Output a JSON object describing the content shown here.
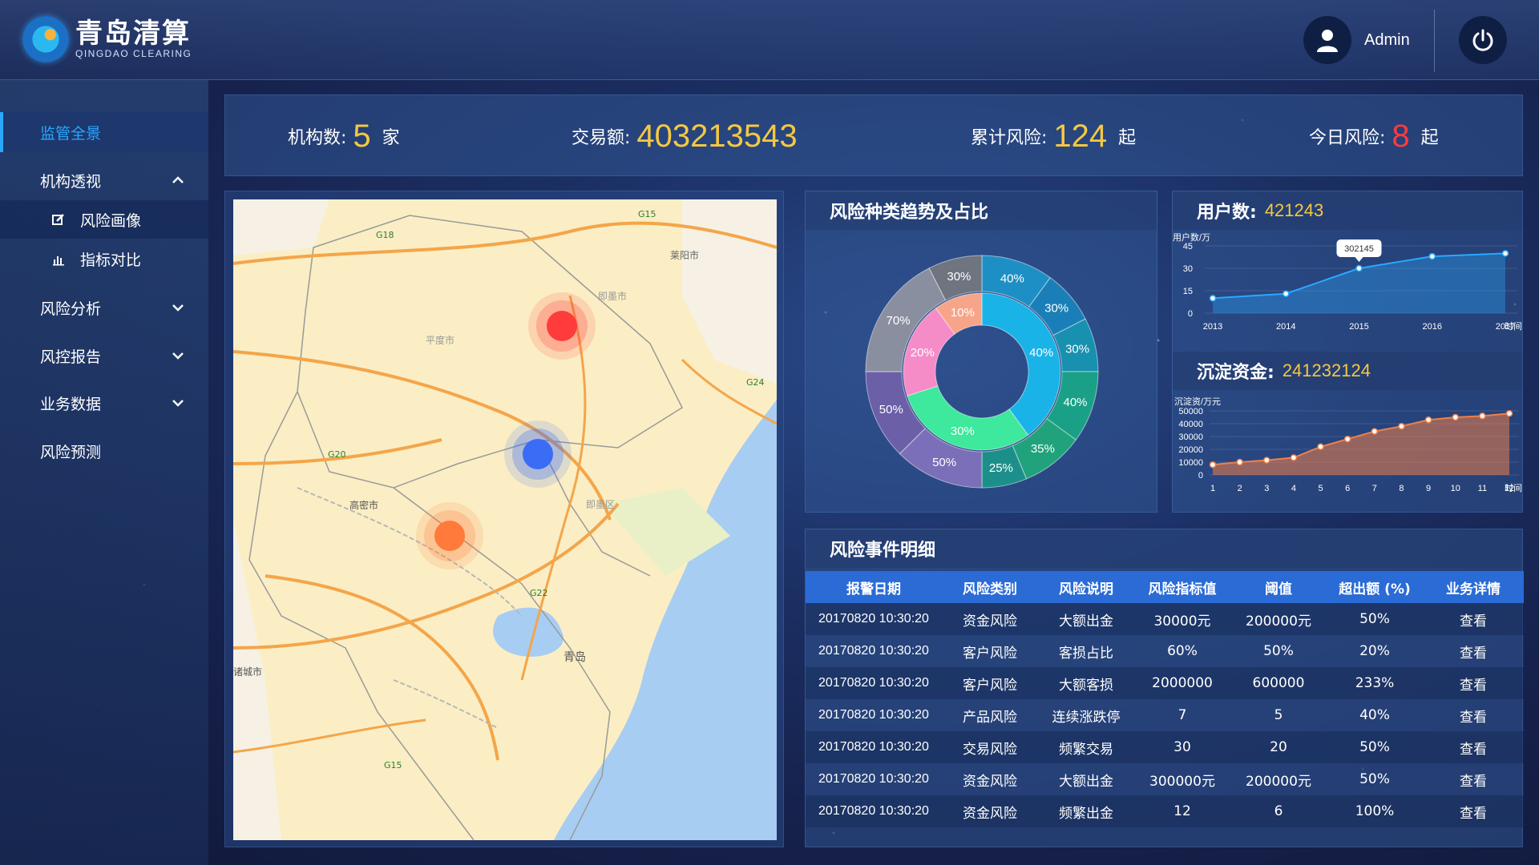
{
  "header": {
    "logo_cn": "青岛清算",
    "logo_en": "QINGDAO CLEARING",
    "user_name": "Admin"
  },
  "sidebar": {
    "items": [
      {
        "label": "监管全景"
      },
      {
        "label": "机构透视"
      },
      {
        "label": "风险画像"
      },
      {
        "label": "指标对比"
      },
      {
        "label": "风险分析"
      },
      {
        "label": "风控报告"
      },
      {
        "label": "业务数据"
      },
      {
        "label": "风险预测"
      }
    ]
  },
  "stats": {
    "org_label": "机构数:",
    "org_value": "5",
    "org_unit": "家",
    "trade_label": "交易额:",
    "trade_value": "403213543",
    "cum_label": "累计风险:",
    "cum_value": "124",
    "cum_unit": "起",
    "today_label": "今日风险:",
    "today_value": "8",
    "today_unit": "起"
  },
  "map": {
    "labels": [
      "G18",
      "G15",
      "莱阳市",
      "即墨市",
      "平度市",
      "G20",
      "G22",
      "G24",
      "高密市",
      "胶州",
      "青岛",
      "诸城市",
      "G15",
      "即墨区"
    ],
    "markers": [
      {
        "color": "#ff3b3b"
      },
      {
        "color": "#3a6cf5"
      },
      {
        "color": "#ff7a3b"
      }
    ]
  },
  "donut": {
    "title": "风险种类趋势及占比",
    "inner": [
      {
        "label": "40%",
        "value": 40,
        "color": "#1ab3e8"
      },
      {
        "label": "30%",
        "value": 30,
        "color": "#3ee89c"
      },
      {
        "label": "20%",
        "value": 20,
        "color": "#f58cc8"
      },
      {
        "label": "10%",
        "value": 10,
        "color": "#f7a58a"
      }
    ],
    "outer": [
      {
        "label": "40%",
        "value": 40,
        "color": "#1e8fc4"
      },
      {
        "label": "30%",
        "value": 30,
        "color": "#1a7fb8"
      },
      {
        "label": "30%",
        "value": 30,
        "color": "#1890b0"
      },
      {
        "label": "40%",
        "value": 40,
        "color": "#1ba088"
      },
      {
        "label": "35%",
        "value": 35,
        "color": "#20a37c"
      },
      {
        "label": "25%",
        "value": 25,
        "color": "#1d8f8a"
      },
      {
        "label": "50%",
        "value": 50,
        "color": "#7a6fb8"
      },
      {
        "label": "50%",
        "value": 50,
        "color": "#6b5fa8"
      },
      {
        "label": "70%",
        "value": 70,
        "color": "#8a8fa0"
      },
      {
        "label": "30%",
        "value": 30,
        "color": "#6e7480"
      }
    ]
  },
  "users": {
    "label": "用户数:",
    "value": "421243",
    "chart_data": {
      "type": "line",
      "ylabel": "用户数/万",
      "xlabel": "时间",
      "yticks": [
        "45",
        "30",
        "15",
        "0"
      ],
      "xticks": [
        "2013",
        "2014",
        "2015",
        "2016",
        "2017"
      ],
      "ylim": [
        0,
        45
      ],
      "x": [
        2013,
        2014,
        2015,
        2016,
        2017
      ],
      "values": [
        10,
        13,
        30,
        38,
        40
      ],
      "annotation": "302145",
      "color": "#2aa8ff"
    }
  },
  "funds": {
    "label": "沉淀资金:",
    "value": "241232124",
    "chart_data": {
      "type": "area",
      "ylabel": "沉淀资/万元",
      "xlabel": "时间",
      "yticks": [
        "50000",
        "40000",
        "30000",
        "20000",
        "10000",
        "0"
      ],
      "xticks": [
        "1",
        "2",
        "3",
        "4",
        "5",
        "6",
        "7",
        "8",
        "9",
        "10",
        "11",
        "12"
      ],
      "ylim": [
        0,
        50000
      ],
      "x": [
        1,
        2,
        3,
        4,
        5,
        6,
        7,
        8,
        9,
        10,
        11,
        12
      ],
      "values": [
        8000,
        10000,
        11500,
        13500,
        22000,
        28000,
        34000,
        38000,
        43000,
        45000,
        46000,
        48000
      ],
      "color": "#f08048"
    }
  },
  "events": {
    "title": "风险事件明细",
    "columns": [
      "报警日期",
      "风险类别",
      "风险说明",
      "风险指标值",
      "阈值",
      "超出额 (%)",
      "业务详情"
    ],
    "rows": [
      [
        "20170820 10:30:20",
        "资金风险",
        "大额出金",
        "30000元",
        "200000元",
        "50%",
        "查看"
      ],
      [
        "20170820 10:30:20",
        "客户风险",
        "客损占比",
        "60%",
        "50%",
        "20%",
        "查看"
      ],
      [
        "20170820 10:30:20",
        "客户风险",
        "大额客损",
        "2000000",
        "600000",
        "233%",
        "查看"
      ],
      [
        "20170820 10:30:20",
        "产品风险",
        "连续涨跌停",
        "7",
        "5",
        "40%",
        "查看"
      ],
      [
        "20170820 10:30:20",
        "交易风险",
        "频繁交易",
        "30",
        "20",
        "50%",
        "查看"
      ],
      [
        "20170820 10:30:20",
        "资金风险",
        "大额出金",
        "300000元",
        "200000元",
        "50%",
        "查看"
      ],
      [
        "20170820 10:30:20",
        "资金风险",
        "频繁出金",
        "12",
        "6",
        "100%",
        "查看"
      ]
    ]
  },
  "colors": {
    "accent": "#2aa8ff",
    "value_yellow": "#f5c842",
    "value_red": "#ff3b3b",
    "table_header": "#2a6bd6"
  }
}
